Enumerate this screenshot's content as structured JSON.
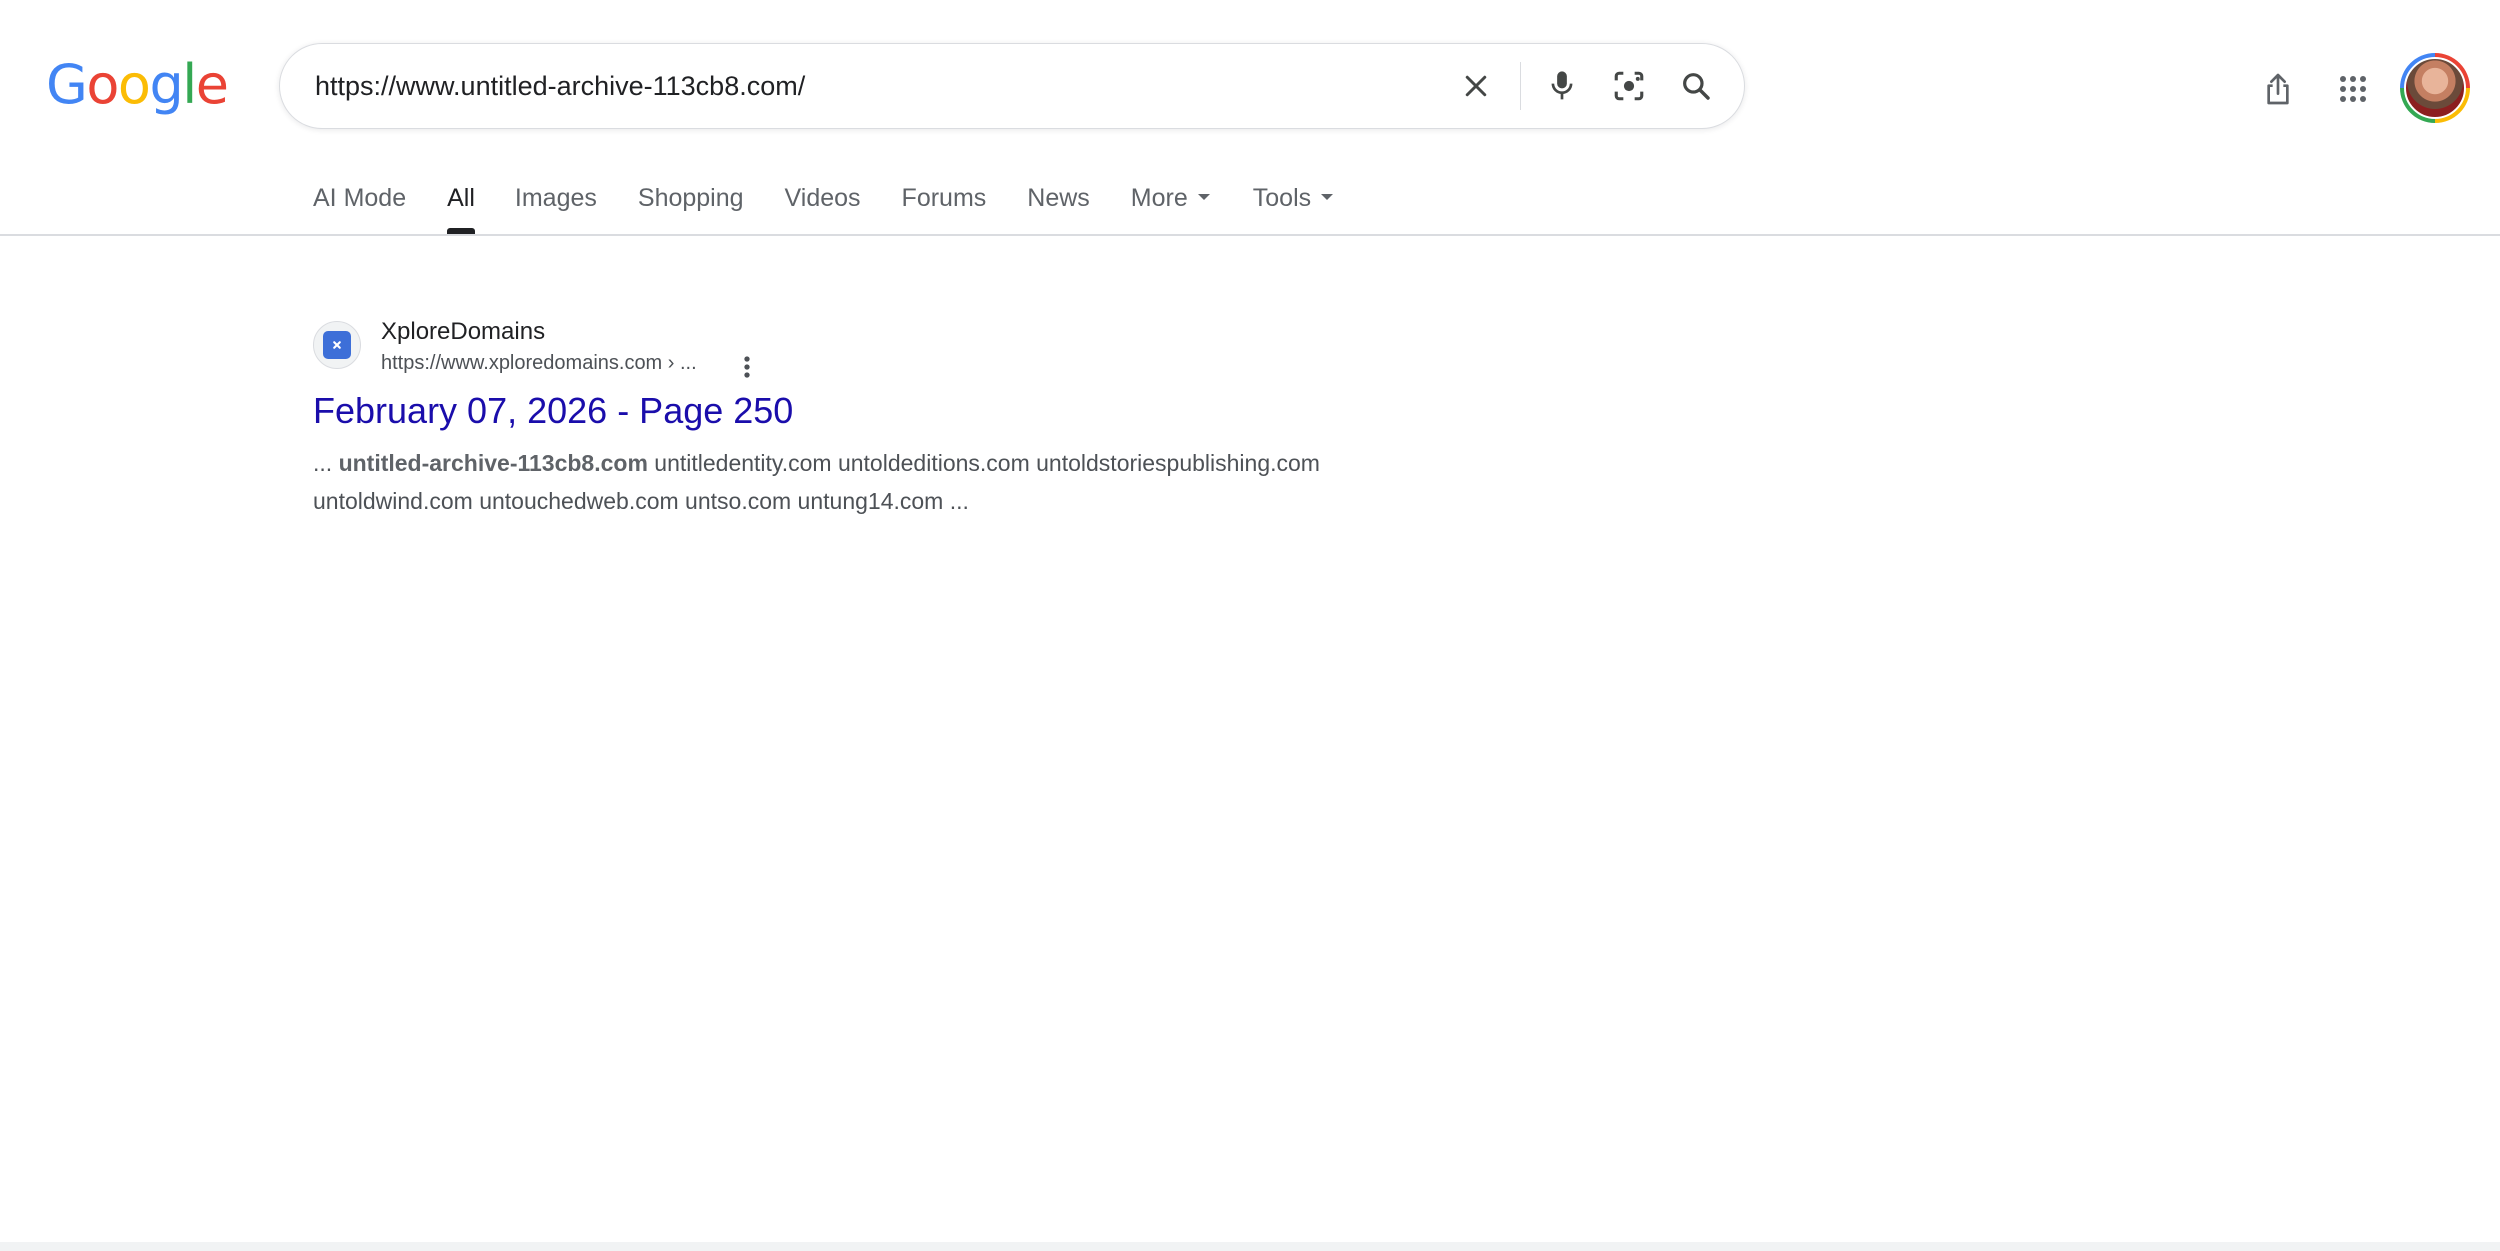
{
  "logo": {
    "letters": [
      "G",
      "o",
      "o",
      "g",
      "l",
      "e"
    ],
    "colors": [
      "#4285f4",
      "#ea4335",
      "#fbbc05",
      "#4285f4",
      "#34a853",
      "#ea4335"
    ]
  },
  "search": {
    "query": "https://www.untitled-archive-113cb8.com/"
  },
  "icons": {
    "clear": "close-icon",
    "voice": "microphone-icon",
    "lens": "camera-lens-icon",
    "search": "search-icon",
    "share": "share-icon",
    "apps": "apps-grid-icon",
    "account": "avatar"
  },
  "tabs": [
    {
      "label": "AI Mode"
    },
    {
      "label": "All",
      "active": true
    },
    {
      "label": "Images"
    },
    {
      "label": "Shopping"
    },
    {
      "label": "Videos"
    },
    {
      "label": "Forums"
    },
    {
      "label": "News"
    },
    {
      "label": "More",
      "dropdown": true
    },
    {
      "label": "Tools",
      "dropdown": true
    }
  ],
  "result": {
    "site_name": "XploreDomains",
    "url": "https://www.xploredomains.com › ...",
    "title": "February 07, 2026 - Page 250",
    "snippet_prefix": "... ",
    "snippet_bold": "untitled-archive-113cb8.com",
    "snippet_rest": " untitledentity.com untoldeditions.com untoldstoriespublishing.com untoldwind.com untouchedweb.com untso.com untung14.com ..."
  },
  "colors": {
    "link": "#1a0dab",
    "text": "#202124",
    "muted": "#4d5156",
    "divider": "#dadce0"
  }
}
